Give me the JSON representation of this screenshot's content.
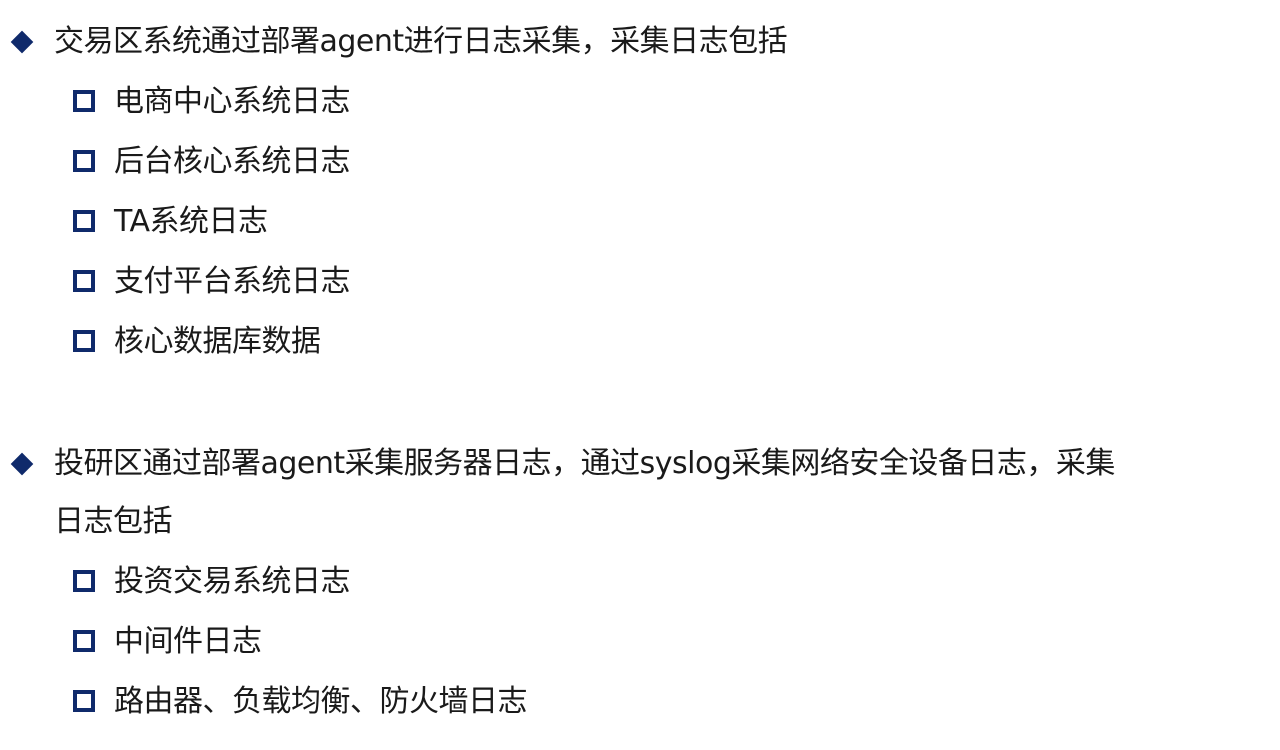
{
  "section_a": {
    "heading": "交易区系统通过部署agent进行日志采集，采集日志包括",
    "items": [
      "电商中心系统日志",
      "后台核心系统日志",
      "TA系统日志",
      "支付平台系统日志",
      "核心数据库数据"
    ]
  },
  "section_b": {
    "heading_line1": "投研区通过部署agent采集服务器日志，通过syslog采集网络安全设备日志，采集",
    "heading_line2": "日志包括",
    "items": [
      "投资交易系统日志",
      "中间件日志",
      "路由器、负载均衡、防火墙日志"
    ]
  },
  "colors": {
    "bullet": "#0f2a6b",
    "text": "#1a1a1a",
    "background": "#ffffff"
  },
  "icons": {
    "primary_bullet": "diamond-bullet-icon",
    "secondary_bullet": "hollow-square-bullet-icon"
  }
}
